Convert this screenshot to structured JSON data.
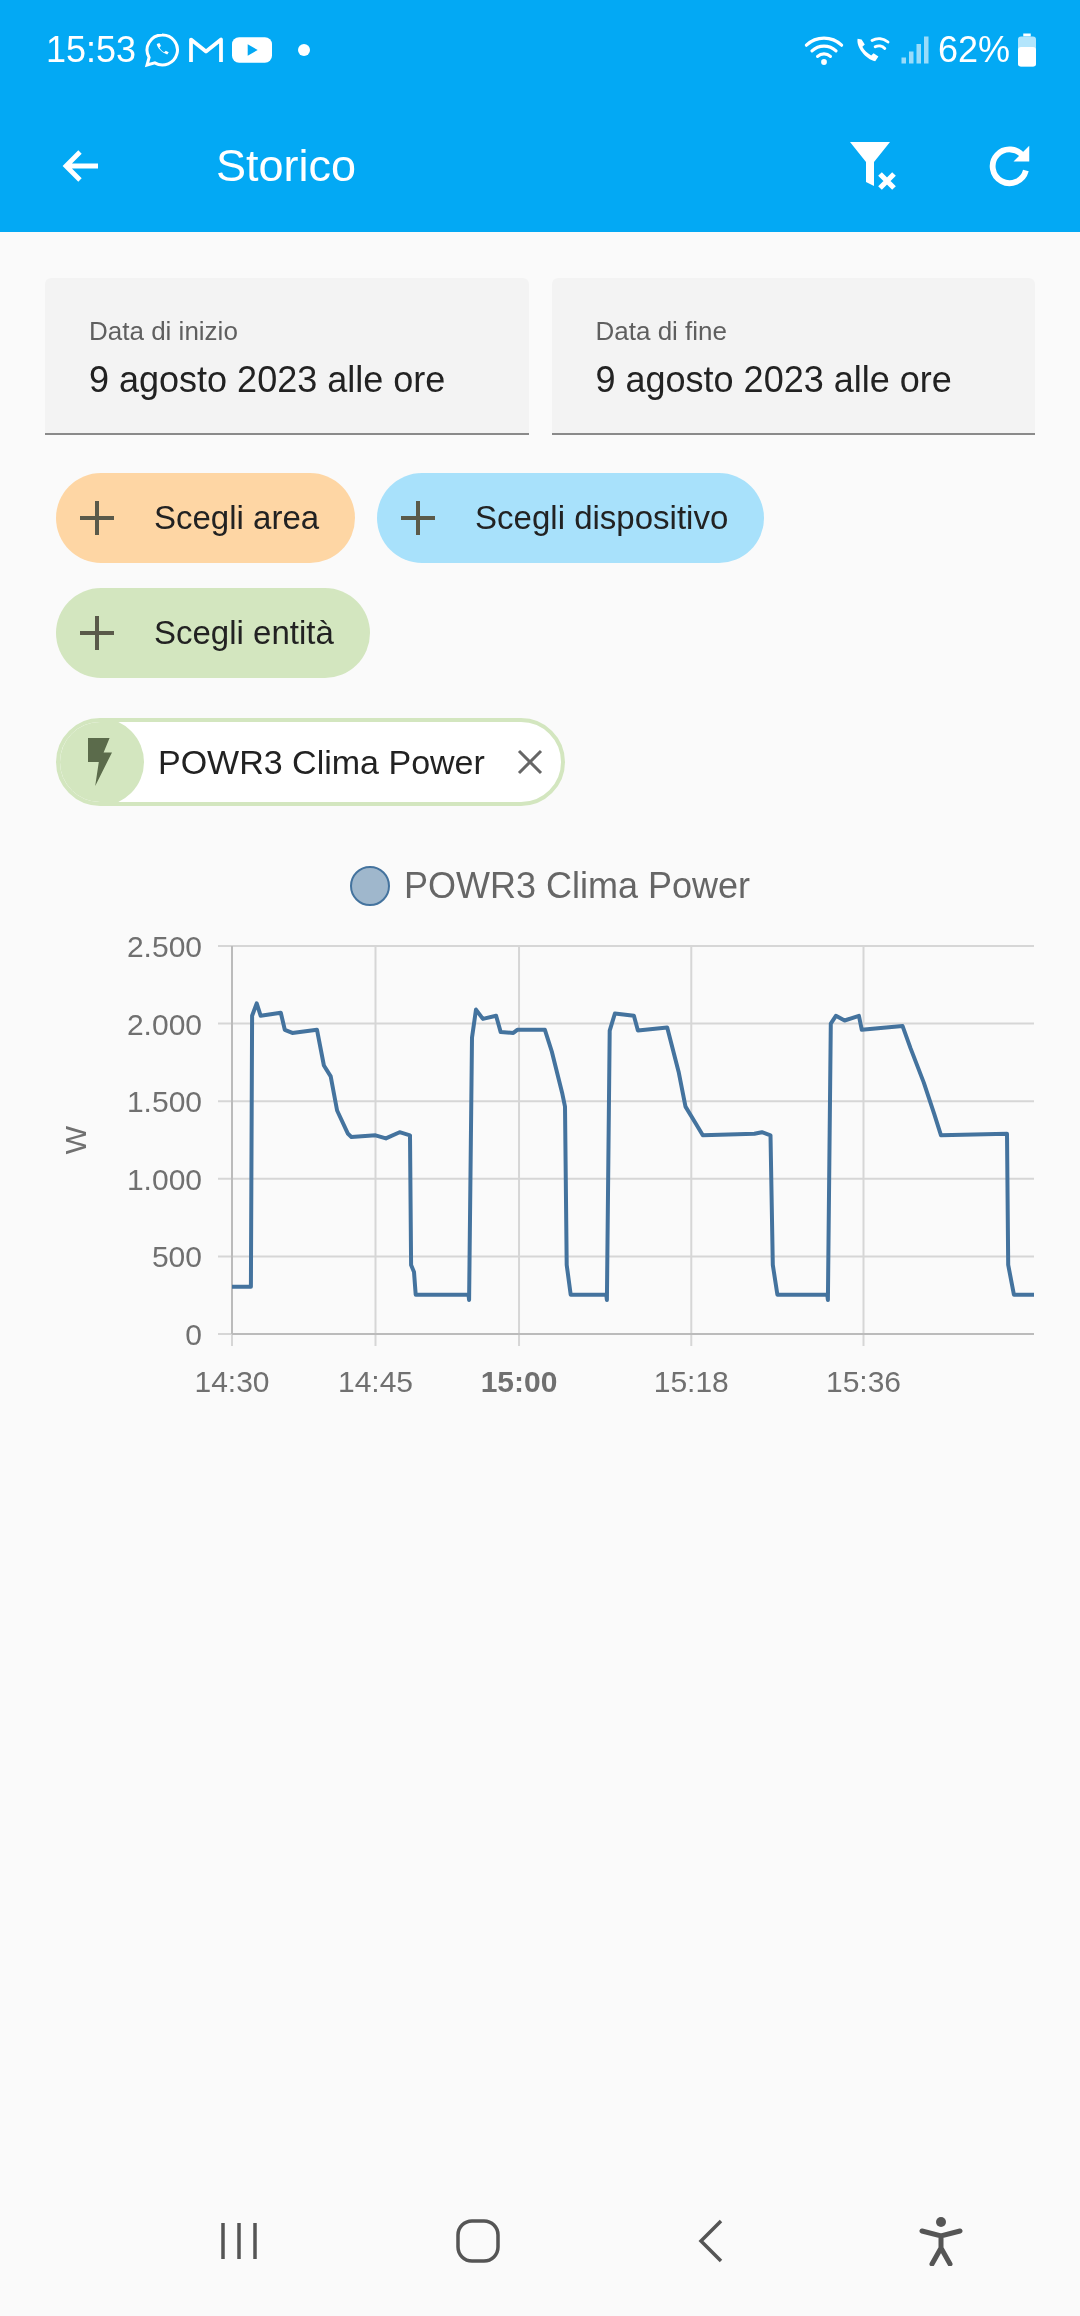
{
  "status_bar": {
    "time": "15:53",
    "battery": "62%"
  },
  "app_bar": {
    "title": "Storico"
  },
  "date_fields": [
    {
      "label": "Data di inizio",
      "value": "9 agosto 2023 alle ore"
    },
    {
      "label": "Data di fine",
      "value": "9 agosto 2023 alle ore"
    }
  ],
  "pickers": [
    {
      "label": "Scegli area",
      "color": "#fed6a4"
    },
    {
      "label": "Scegli dispositivo",
      "color": "#a8e1fb"
    },
    {
      "label": "Scegli entità",
      "color": "#d3e6bf"
    }
  ],
  "selected_entities": [
    {
      "label": "POWR3 Clima Power",
      "color": "#d3e6bf"
    }
  ],
  "chart": {
    "chart_data": {
      "type": "line",
      "grid": true,
      "ylabel": "W",
      "xlim": [
        14.5,
        15.897
      ],
      "ylim": [
        0,
        2500
      ],
      "xticks": [
        {
          "value": 14.5,
          "label": "14:30"
        },
        {
          "value": 14.75,
          "label": "14:45"
        },
        {
          "value": 15,
          "label": "15:00"
        },
        {
          "value": 15.3,
          "label": "15:18"
        },
        {
          "value": 15.6,
          "label": "15:36"
        }
      ],
      "yticks": [
        {
          "value": 0,
          "label": "0"
        },
        {
          "value": 500,
          "label": "500"
        },
        {
          "value": 1000,
          "label": "1.000"
        },
        {
          "value": 1500,
          "label": "1.500"
        },
        {
          "value": 2000,
          "label": "2.000"
        },
        {
          "value": 2500,
          "label": "2.500"
        }
      ],
      "x": [
        14.5,
        14.533,
        14.535,
        14.543,
        14.55,
        14.585,
        14.592,
        14.605,
        14.648,
        14.66,
        14.672,
        14.683,
        14.702,
        14.708,
        14.75,
        14.768,
        14.792,
        14.81,
        14.812,
        14.817,
        14.82,
        14.912,
        14.913,
        14.918,
        14.925,
        14.937,
        14.96,
        14.968,
        14.99,
        14.997,
        15.045,
        15.057,
        15.075,
        15.08,
        15.083,
        15.09,
        15.152,
        15.153,
        15.158,
        15.167,
        15.2,
        15.207,
        15.258,
        15.278,
        15.29,
        15.308,
        15.32,
        15.41,
        15.423,
        15.438,
        15.442,
        15.45,
        15.537,
        15.538,
        15.543,
        15.552,
        15.567,
        15.592,
        15.597,
        15.668,
        15.682,
        15.705,
        15.723,
        15.735,
        15.85,
        15.852,
        15.862,
        15.897
      ],
      "series": [
        {
          "name": "POWR3 Clima Power",
          "color": "#44739e",
          "values": [
            305,
            305,
            2050,
            2130,
            2050,
            2070,
            1960,
            1940,
            1960,
            1730,
            1660,
            1440,
            1290,
            1270,
            1280,
            1260,
            1300,
            1280,
            445,
            400,
            253,
            253,
            220,
            1910,
            2090,
            2030,
            2050,
            1945,
            1940,
            1960,
            1960,
            1820,
            1555,
            1465,
            445,
            253,
            253,
            220,
            1955,
            2065,
            2050,
            1955,
            1975,
            1690,
            1465,
            1355,
            1280,
            1290,
            1300,
            1280,
            445,
            253,
            253,
            220,
            2000,
            2050,
            2020,
            2050,
            1960,
            1985,
            1840,
            1620,
            1420,
            1280,
            1290,
            445,
            253,
            253
          ]
        }
      ]
    }
  }
}
